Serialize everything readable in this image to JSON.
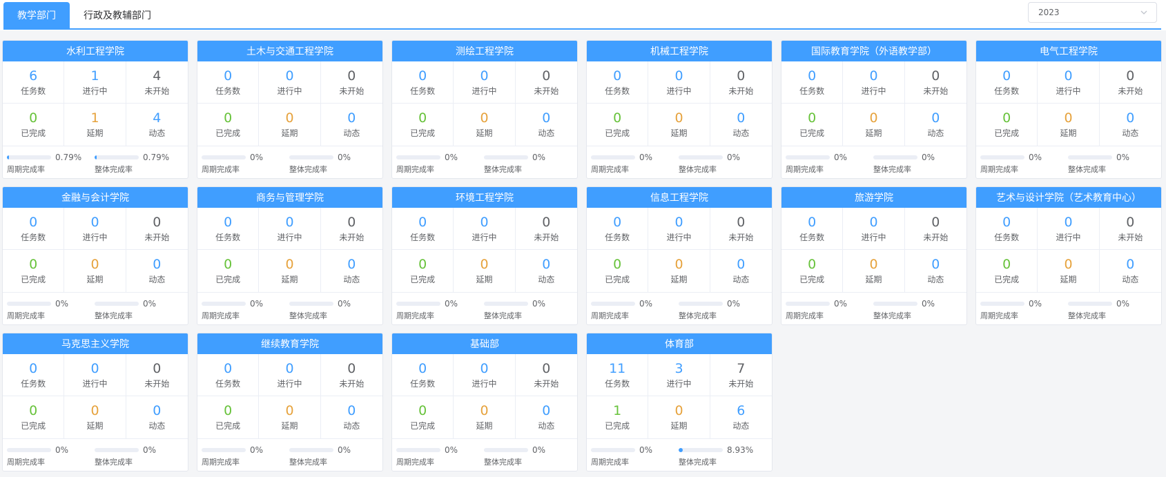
{
  "tabs": [
    {
      "label": "教学部门",
      "active": true
    },
    {
      "label": "行政及教辅部门",
      "active": false
    }
  ],
  "year_select": {
    "value": "2023"
  },
  "labels": {
    "tasks": "任务数",
    "in_progress": "进行中",
    "not_started": "未开始",
    "completed": "已完成",
    "delayed": "延期",
    "dynamic": "动态",
    "period_rate": "周期完成率",
    "overall_rate": "整体完成率"
  },
  "colors": {
    "primary": "#409eff",
    "green": "#67c23a",
    "orange": "#e6a23c",
    "gray": "#606266"
  },
  "cards": [
    {
      "title": "水利工程学院",
      "tasks": "6",
      "in_progress": "1",
      "not_started": "4",
      "completed": "0",
      "delayed": "1",
      "dynamic": "4",
      "period_rate": "0.79%",
      "overall_rate": "0.79%"
    },
    {
      "title": "土木与交通工程学院",
      "tasks": "0",
      "in_progress": "0",
      "not_started": "0",
      "completed": "0",
      "delayed": "0",
      "dynamic": "0",
      "period_rate": "0%",
      "overall_rate": "0%"
    },
    {
      "title": "测绘工程学院",
      "tasks": "0",
      "in_progress": "0",
      "not_started": "0",
      "completed": "0",
      "delayed": "0",
      "dynamic": "0",
      "period_rate": "0%",
      "overall_rate": "0%"
    },
    {
      "title": "机械工程学院",
      "tasks": "0",
      "in_progress": "0",
      "not_started": "0",
      "completed": "0",
      "delayed": "0",
      "dynamic": "0",
      "period_rate": "0%",
      "overall_rate": "0%"
    },
    {
      "title": "国际教育学院（外语教学部）",
      "tasks": "0",
      "in_progress": "0",
      "not_started": "0",
      "completed": "0",
      "delayed": "0",
      "dynamic": "0",
      "period_rate": "0%",
      "overall_rate": "0%"
    },
    {
      "title": "电气工程学院",
      "tasks": "0",
      "in_progress": "0",
      "not_started": "0",
      "completed": "0",
      "delayed": "0",
      "dynamic": "0",
      "period_rate": "0%",
      "overall_rate": "0%"
    },
    {
      "title": "金融与会计学院",
      "tasks": "0",
      "in_progress": "0",
      "not_started": "0",
      "completed": "0",
      "delayed": "0",
      "dynamic": "0",
      "period_rate": "0%",
      "overall_rate": "0%"
    },
    {
      "title": "商务与管理学院",
      "tasks": "0",
      "in_progress": "0",
      "not_started": "0",
      "completed": "0",
      "delayed": "0",
      "dynamic": "0",
      "period_rate": "0%",
      "overall_rate": "0%"
    },
    {
      "title": "环境工程学院",
      "tasks": "0",
      "in_progress": "0",
      "not_started": "0",
      "completed": "0",
      "delayed": "0",
      "dynamic": "0",
      "period_rate": "0%",
      "overall_rate": "0%"
    },
    {
      "title": "信息工程学院",
      "tasks": "0",
      "in_progress": "0",
      "not_started": "0",
      "completed": "0",
      "delayed": "0",
      "dynamic": "0",
      "period_rate": "0%",
      "overall_rate": "0%"
    },
    {
      "title": "旅游学院",
      "tasks": "0",
      "in_progress": "0",
      "not_started": "0",
      "completed": "0",
      "delayed": "0",
      "dynamic": "0",
      "period_rate": "0%",
      "overall_rate": "0%"
    },
    {
      "title": "艺术与设计学院（艺术教育中心）",
      "tasks": "0",
      "in_progress": "0",
      "not_started": "0",
      "completed": "0",
      "delayed": "0",
      "dynamic": "0",
      "period_rate": "0%",
      "overall_rate": "0%"
    },
    {
      "title": "马克思主义学院",
      "tasks": "0",
      "in_progress": "0",
      "not_started": "0",
      "completed": "0",
      "delayed": "0",
      "dynamic": "0",
      "period_rate": "0%",
      "overall_rate": "0%"
    },
    {
      "title": "继续教育学院",
      "tasks": "0",
      "in_progress": "0",
      "not_started": "0",
      "completed": "0",
      "delayed": "0",
      "dynamic": "0",
      "period_rate": "0%",
      "overall_rate": "0%"
    },
    {
      "title": "基础部",
      "tasks": "0",
      "in_progress": "0",
      "not_started": "0",
      "completed": "0",
      "delayed": "0",
      "dynamic": "0",
      "period_rate": "0%",
      "overall_rate": "0%"
    },
    {
      "title": "体育部",
      "tasks": "11",
      "in_progress": "3",
      "not_started": "7",
      "completed": "1",
      "delayed": "0",
      "dynamic": "6",
      "period_rate": "0%",
      "overall_rate": "8.93%"
    }
  ]
}
